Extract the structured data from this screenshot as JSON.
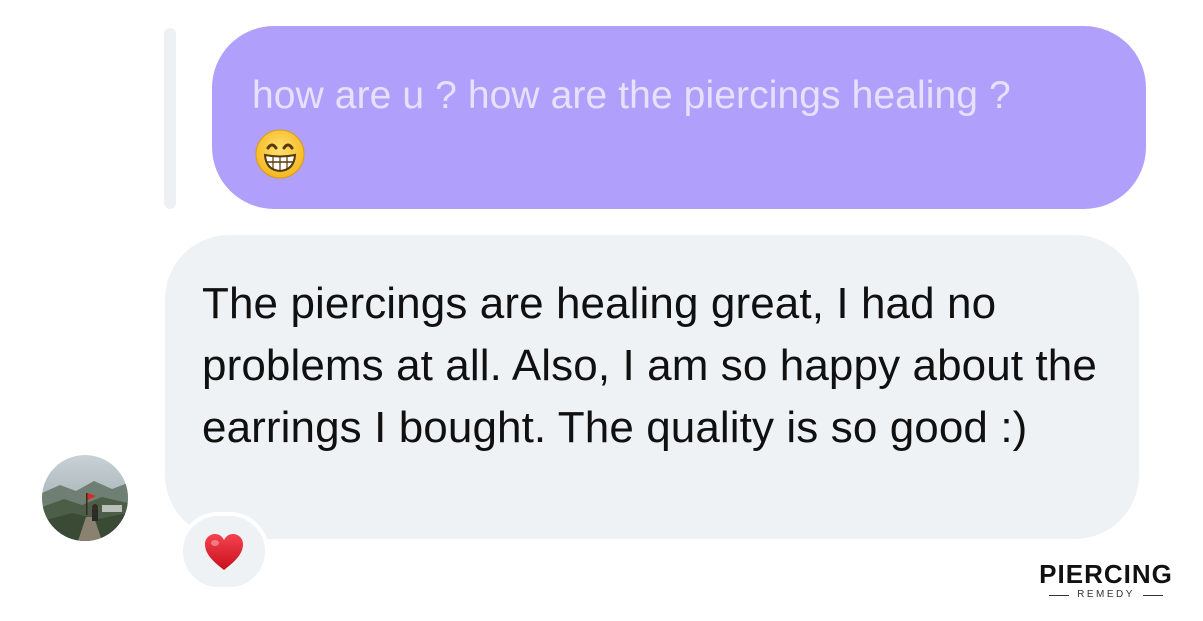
{
  "conversation": {
    "sent_message": {
      "text": "how are u ? how are the piercings healing ?",
      "emoji": "grinning-face-with-smiling-eyes"
    },
    "received_message": {
      "text": "The piercings are healing great, I had no problems at all. Also, I am so happy about the earrings I bought. The quality is so good :)",
      "reaction": "red-heart"
    },
    "avatar": "contact-avatar-landscape-photo"
  },
  "brand": {
    "name": "PIERCING",
    "subtitle": "REMEDY"
  },
  "colors": {
    "sent_bubble": "#b1a0fb",
    "sent_text": "#e7e1fd",
    "received_bubble": "#eff2f5",
    "received_text": "#101010",
    "reply_bar": "#eef1f4",
    "heart": "#e3202c"
  }
}
